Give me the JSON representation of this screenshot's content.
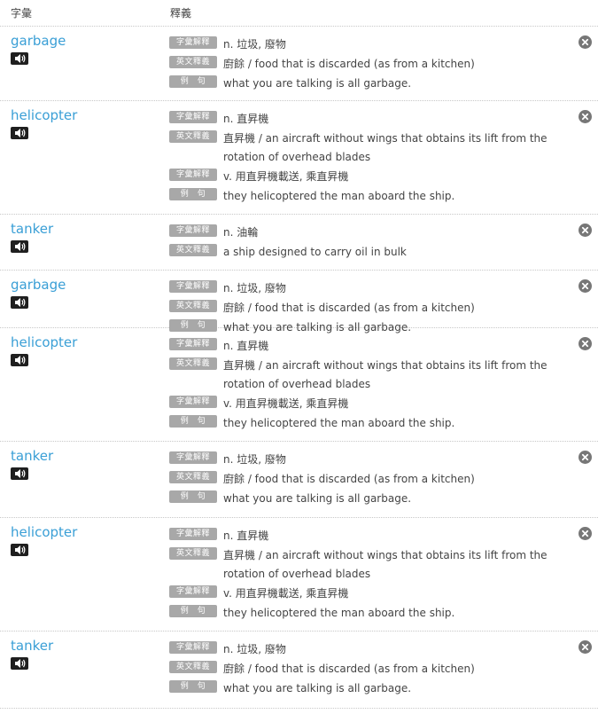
{
  "header": {
    "word_col": "字彙",
    "def_col": "釋義"
  },
  "entries": [
    {
      "word": "garbage",
      "lines": [
        {
          "tag": "字彙解釋",
          "text": "n. 垃圾, 廢物"
        },
        {
          "tag": "英文釋義",
          "text": "廚餘 / food that is discarded (as from a kitchen)"
        },
        {
          "tag": "例　句",
          "text": "what you are talking is all garbage."
        }
      ]
    },
    {
      "word": "helicopter",
      "lines": [
        {
          "tag": "字彙解釋",
          "text": "n. 直昇機"
        },
        {
          "tag": "英文釋義",
          "text": "直昇機 / an aircraft without wings that obtains its lift from the rotation of overhead blades"
        },
        {
          "tag": "字彙解釋",
          "text": "v. 用直昇機載送, 乘直昇機"
        },
        {
          "tag": "例　句",
          "text": "they helicoptered the man aboard the ship."
        }
      ]
    },
    {
      "word": "tanker",
      "lines": [
        {
          "tag": "字彙解釋",
          "text": "n. 油輪"
        },
        {
          "tag": "英文釋義",
          "text": "a ship designed to carry oil in bulk"
        }
      ]
    },
    {
      "word": "garbage",
      "lines": [
        {
          "tag": "字彙解釋",
          "text": "n. 垃圾, 廢物"
        },
        {
          "tag": "英文釋義",
          "text": "廚餘 / food that is discarded (as from a kitchen)"
        },
        {
          "tag": "例　句",
          "text": "what you are talking is all garbage."
        }
      ]
    },
    {
      "word": "helicopter",
      "lines": [
        {
          "tag": "字彙解釋",
          "text": "n. 直昇機"
        },
        {
          "tag": "英文釋義",
          "text": "直昇機 / an aircraft without wings that obtains its lift from the rotation of overhead blades"
        },
        {
          "tag": "字彙解釋",
          "text": "v. 用直昇機載送, 乘直昇機"
        },
        {
          "tag": "例　句",
          "text": "they helicoptered the man aboard the ship."
        }
      ]
    },
    {
      "word": "tanker",
      "lines": [
        {
          "tag": "字彙解釋",
          "text": "n. 垃圾, 廢物"
        },
        {
          "tag": "英文釋義",
          "text": "廚餘 / food that is discarded (as from a kitchen)"
        },
        {
          "tag": "例　句",
          "text": "what you are talking is all garbage."
        }
      ]
    },
    {
      "word": "helicopter",
      "lines": [
        {
          "tag": "字彙解釋",
          "text": "n. 直昇機"
        },
        {
          "tag": "英文釋義",
          "text": "直昇機 / an aircraft without wings that obtains its lift from the rotation of overhead blades"
        },
        {
          "tag": "字彙解釋",
          "text": "v. 用直昇機載送, 乘直昇機"
        },
        {
          "tag": "例　句",
          "text": "they helicoptered the man aboard the ship."
        }
      ]
    },
    {
      "word": "tanker",
      "lines": [
        {
          "tag": "字彙解釋",
          "text": "n. 垃圾, 廢物"
        },
        {
          "tag": "英文釋義",
          "text": "廚餘 / food that is discarded (as from a kitchen)"
        },
        {
          "tag": "例　句",
          "text": "what you are talking is all garbage."
        }
      ]
    }
  ],
  "icons": {
    "audio": "speaker-icon",
    "remove": "close-icon"
  },
  "colors": {
    "word_link": "#3a9fd6",
    "tag_bg": "#a8a8a8",
    "close_bg": "#777777"
  }
}
